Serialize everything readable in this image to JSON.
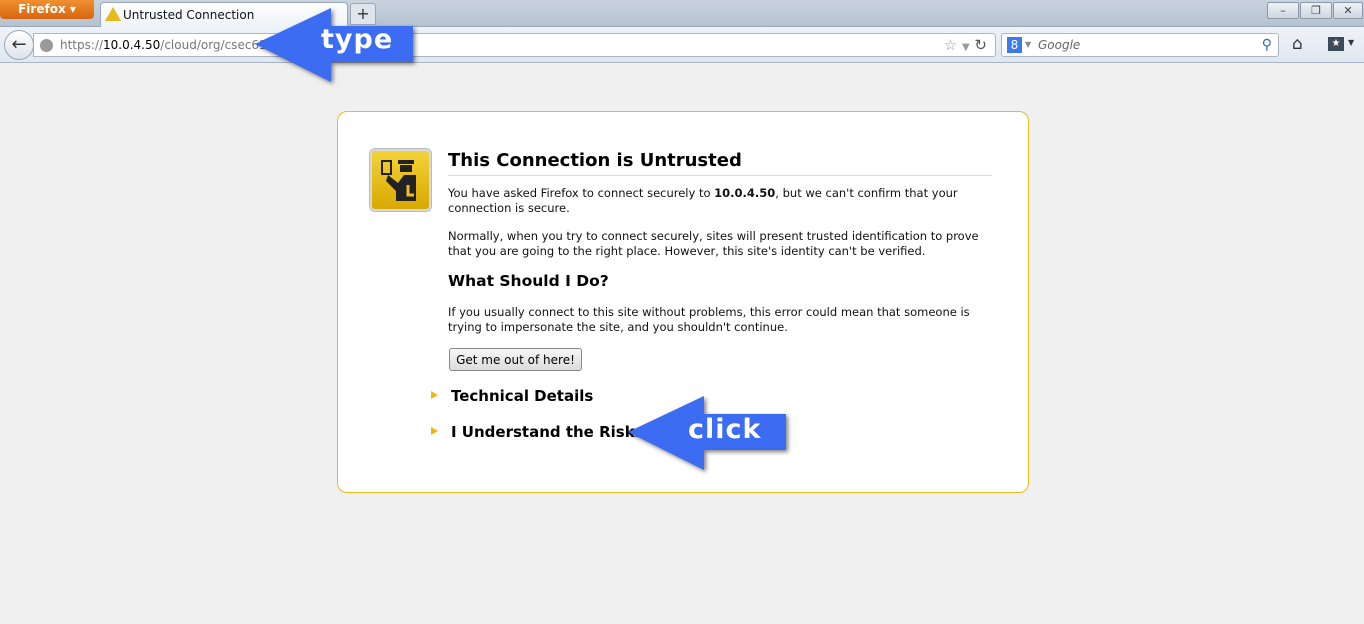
{
  "browser": {
    "menu_button": "Firefox ▾",
    "tab_title": "Untrusted Connection",
    "new_tab": "+",
    "window_controls": [
      "–",
      "❐",
      "✕"
    ],
    "url_scheme": "https://",
    "url_host": "10.0.4.50",
    "url_path": "/cloud/org/csec610",
    "search_engine_icon": "8",
    "search_placeholder": "Google"
  },
  "page": {
    "title": "This Connection is Untrusted",
    "p1_before": "You have asked Firefox to connect securely to ",
    "p1_host": "10.0.4.50",
    "p1_after": ", but we can't confirm that your connection is secure.",
    "p2": "Normally, when you try to connect securely, sites will present trusted identification to prove that you are going to the right place. However, this site's identity can't be verified.",
    "heading2": "What Should I Do?",
    "p3": "If you usually connect to this site without problems, this error could mean that someone is trying to impersonate the site, and you shouldn't continue.",
    "get_out_button": "Get me out of here!",
    "technical_details": "Technical Details",
    "understand_risks": "I Understand the Risks"
  },
  "annotations": {
    "type_label": "type",
    "click_label": "click",
    "arrow_color": "#3b6cf2"
  }
}
